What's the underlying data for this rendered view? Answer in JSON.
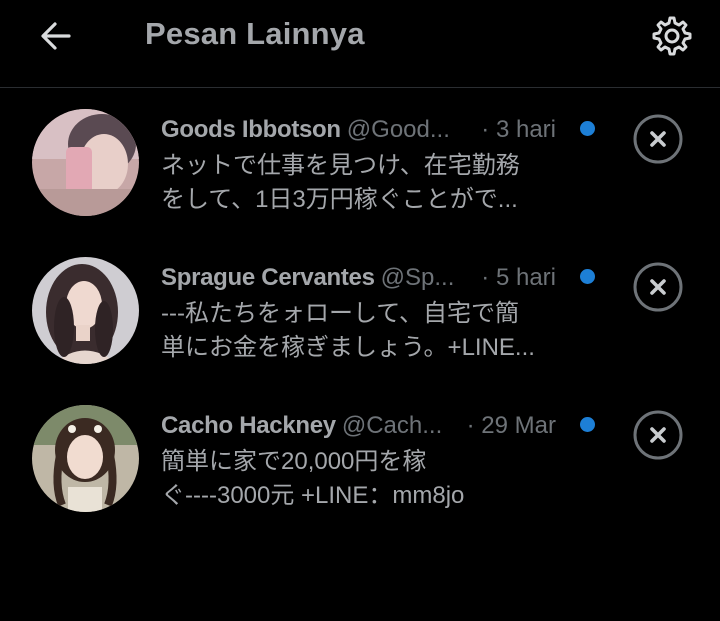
{
  "header": {
    "title": "Pesan Lainnya",
    "back_icon": "arrow-left-icon",
    "settings_icon": "gear-icon"
  },
  "colors": {
    "background": "#000000",
    "title_text": "#a4a7ab",
    "muted_text": "#6e7378",
    "unread_dot": "#1d7fd6",
    "divider": "#2a2d31"
  },
  "conversations": [
    {
      "name": "Goods Ibbotson",
      "handle": "@Good...",
      "time": "· 3 hari",
      "preview_line1": "ネットで仕事を見つけ、在宅勤務",
      "preview_line2": "をして、1日3万円稼ぐことがで...",
      "unread": true,
      "dismiss_icon": "close-circle-icon"
    },
    {
      "name": "Sprague Cervantes",
      "handle": "@Sp...",
      "time": "· 5 hari",
      "preview_line1": "---私たちをォローして、自宅で簡",
      "preview_line2": "単にお金を稼ぎましょう。+LINE...",
      "unread": true,
      "dismiss_icon": "close-circle-icon"
    },
    {
      "name": "Cacho Hackney",
      "handle": "@Cach...",
      "time": "· 29 Mar",
      "preview_line1": "簡単に家で20,000円を稼",
      "preview_line2": "ぐ----3000元 +LINE：mm8jo",
      "unread": true,
      "dismiss_icon": "close-circle-icon"
    }
  ]
}
